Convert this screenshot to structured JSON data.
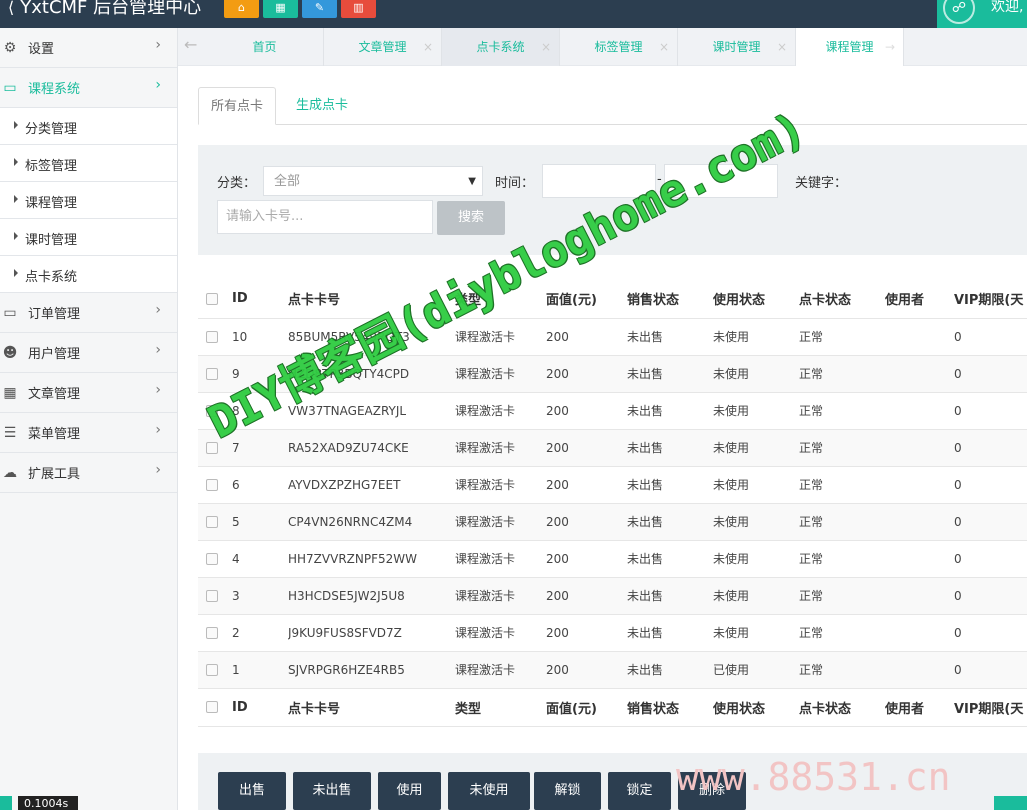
{
  "topbar": {
    "brand": "YxtCMF 后台管理中心",
    "buttons": [
      {
        "icon": "home-icon",
        "color": "#f39c12",
        "glyph": "⌂"
      },
      {
        "icon": "grid-icon",
        "color": "#1abc9c",
        "glyph": "▦"
      },
      {
        "icon": "edit-icon",
        "color": "#3498db",
        "glyph": "✎"
      },
      {
        "icon": "trash-icon",
        "color": "#e74c3c",
        "glyph": "▥"
      }
    ],
    "welcome": "欢迎,"
  },
  "sidebar": {
    "items": [
      {
        "label": "设置",
        "icon": "gear-icon",
        "glyph": "⚙"
      },
      {
        "label": "课程系统",
        "icon": "monitor-icon",
        "glyph": "▭",
        "active": true
      },
      {
        "label": "订单管理",
        "icon": "desktop-icon",
        "glyph": "▭"
      },
      {
        "label": "用户管理",
        "icon": "users-icon",
        "glyph": "☻"
      },
      {
        "label": "文章管理",
        "icon": "apps-icon",
        "glyph": "▦"
      },
      {
        "label": "菜单管理",
        "icon": "list-icon",
        "glyph": "☰"
      },
      {
        "label": "扩展工具",
        "icon": "cloud-icon",
        "glyph": "☁"
      }
    ],
    "sub_items": [
      "分类管理",
      "标签管理",
      "课程管理",
      "课时管理",
      "点卡系统"
    ],
    "zoom": "0.1004s"
  },
  "tabs": [
    {
      "label": "首页",
      "closable": false
    },
    {
      "label": "文章管理",
      "closable": true
    },
    {
      "label": "点卡系统",
      "closable": true,
      "active": true
    },
    {
      "label": "标签管理",
      "closable": true
    },
    {
      "label": "课时管理",
      "closable": true
    },
    {
      "label": "课程管理",
      "closable": true
    }
  ],
  "subtabs": {
    "all": "所有点卡",
    "generate": "生成点卡"
  },
  "filter": {
    "category_label": "分类：",
    "category_value": "全部",
    "time_label": "时间：",
    "dash": "-",
    "keyword_label": "关键字：",
    "card_placeholder": "请输入卡号...",
    "search_button": "搜索"
  },
  "table": {
    "headers": [
      "ID",
      "点卡卡号",
      "类型",
      "面值(元)",
      "销售状态",
      "使用状态",
      "点卡状态",
      "使用者",
      "VIP期限(天"
    ],
    "rows": [
      {
        "id": "10",
        "card": "85BUM5RV549RQT3",
        "type": "课程激活卡",
        "value": "200",
        "sale": "未出售",
        "use": "未使用",
        "status": "正常",
        "user": "",
        "vip": "0"
      },
      {
        "id": "9",
        "card": "HZD8TP3BQTY4CPD",
        "type": "课程激活卡",
        "value": "200",
        "sale": "未出售",
        "use": "未使用",
        "status": "正常",
        "user": "",
        "vip": "0"
      },
      {
        "id": "8",
        "card": "VW37TNAGEAZRYJL",
        "type": "课程激活卡",
        "value": "200",
        "sale": "未出售",
        "use": "未使用",
        "status": "正常",
        "user": "",
        "vip": "0"
      },
      {
        "id": "7",
        "card": "RA52XAD9ZU74CKE",
        "type": "课程激活卡",
        "value": "200",
        "sale": "未出售",
        "use": "未使用",
        "status": "正常",
        "user": "",
        "vip": "0"
      },
      {
        "id": "6",
        "card": "AYVDXZPZHG7EET",
        "type": "课程激活卡",
        "value": "200",
        "sale": "未出售",
        "use": "未使用",
        "status": "正常",
        "user": "",
        "vip": "0"
      },
      {
        "id": "5",
        "card": "CP4VN26NRNC4ZM4",
        "type": "课程激活卡",
        "value": "200",
        "sale": "未出售",
        "use": "未使用",
        "status": "正常",
        "user": "",
        "vip": "0"
      },
      {
        "id": "4",
        "card": "HH7ZVVRZNPF52WW",
        "type": "课程激活卡",
        "value": "200",
        "sale": "未出售",
        "use": "未使用",
        "status": "正常",
        "user": "",
        "vip": "0"
      },
      {
        "id": "3",
        "card": "H3HCDSE5JW2J5U8",
        "type": "课程激活卡",
        "value": "200",
        "sale": "未出售",
        "use": "未使用",
        "status": "正常",
        "user": "",
        "vip": "0"
      },
      {
        "id": "2",
        "card": "J9KU9FUS8SFVD7Z",
        "type": "课程激活卡",
        "value": "200",
        "sale": "未出售",
        "use": "未使用",
        "status": "正常",
        "user": "",
        "vip": "0"
      },
      {
        "id": "1",
        "card": "SJVRPGR6HZE4RB5",
        "type": "课程激活卡",
        "value": "200",
        "sale": "未出售",
        "use": "已使用",
        "status": "正常",
        "user": "",
        "vip": "0"
      }
    ]
  },
  "actions": [
    "出售",
    "未出售",
    "使用",
    "未使用",
    "解锁",
    "锁定",
    "删除"
  ],
  "watermark": "DIY博客园(diybloghome.com)",
  "watermark2": "www.88531.cn"
}
